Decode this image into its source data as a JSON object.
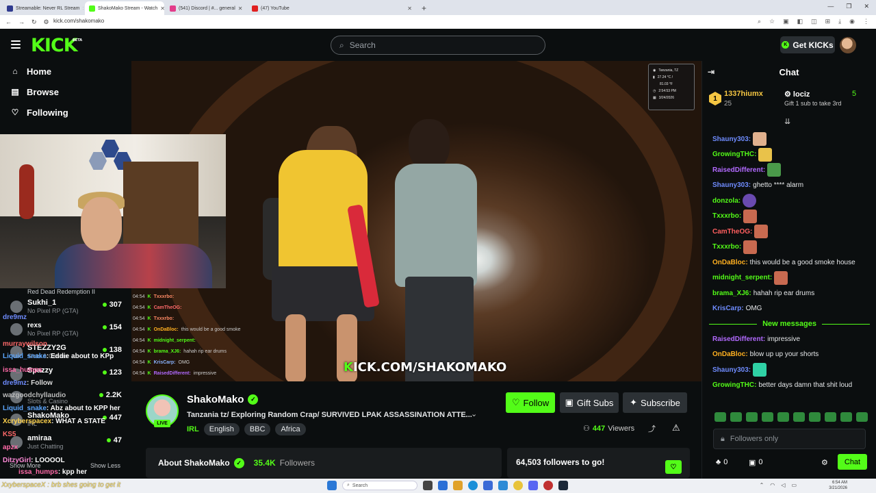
{
  "browser": {
    "tabs": [
      {
        "title": "Streamable: Never RL Stream",
        "active": false,
        "fav_color": "#2f3a8f"
      },
      {
        "title": "ShakoMako Stream - Watch",
        "active": true,
        "fav_color": "#53fc18"
      },
      {
        "title": "(541) Discord | #... general",
        "active": false,
        "fav_color": "#e23c8a"
      },
      {
        "title": "(47) YouTube",
        "active": false,
        "fav_color": "#e02020"
      }
    ],
    "new_tab": "+",
    "url": "kick.com/shakomako"
  },
  "header": {
    "logo": "KICK",
    "logo_badge": "BETA",
    "search_placeholder": "Search",
    "get_kicks": "Get KICKs"
  },
  "nav": [
    {
      "label": "Home",
      "icon": "home-icon"
    },
    {
      "label": "Browse",
      "icon": "browse-icon"
    },
    {
      "label": "Following",
      "icon": "heart-icon"
    }
  ],
  "webcam": {
    "caption": "Red Dead Redemption II"
  },
  "channels": [
    {
      "name": "Sukhi_1",
      "category": "No Pixel RP (GTA)",
      "viewers": "307"
    },
    {
      "name": "",
      "category": "No Pixel RP (GTA)",
      "viewers": "154"
    },
    {
      "name": "STEZZY2G",
      "category": "Slots & Casino",
      "viewers": "138"
    },
    {
      "name": "Spazzy",
      "category": "",
      "viewers": "123"
    },
    {
      "name": "",
      "category": "Slots & Casino",
      "viewers": "2.2K"
    },
    {
      "name": "ShakoMako",
      "category": "IRL",
      "viewers": "447"
    },
    {
      "name": "amiraa",
      "category": "Just Chatting",
      "viewers": "47"
    }
  ],
  "ghost_chat": [
    {
      "user": "dre9mz",
      "text": "",
      "color": "#6f8cff"
    },
    {
      "user": "rexs",
      "text": "",
      "color": "#ffffff"
    },
    {
      "user": "murraywilson",
      "text": ": Eddie about to KPp",
      "color": "#ff6a6a"
    },
    {
      "user": "Liquid_snake",
      "text": "",
      "color": "#5da7ff"
    },
    {
      "user": "issa_humps",
      "text": "",
      "color": "#ff6aa8"
    },
    {
      "user": "dre9mz",
      "text": ": Follow",
      "color": "#6f8cff"
    },
    {
      "user": "wazgoodchyllaudio",
      "text": "",
      "color": "#bbbbbb"
    },
    {
      "user": "Liquid_snake",
      "text": ": Abz about to KPP her",
      "color": "#5da7ff"
    },
    {
      "user": "Xcryberspacex",
      "text": ": WHAT A STATE",
      "color": "#ffd34d"
    },
    {
      "user": "KS5",
      "text": "",
      "color": "#ff6a6a"
    },
    {
      "user": "apzx",
      "text": "",
      "color": "#ff6aa8"
    },
    {
      "user": "DitzyGirl",
      "text": ": LOOOOL",
      "color": "#ff8ad8"
    },
    {
      "user": "issa_humps",
      "text": ": kpp her",
      "color": "#ff6aa8"
    }
  ],
  "sidebar_footer": {
    "show_more": "Show More",
    "show_less": "Show Less"
  },
  "video": {
    "location": "Tanzania, TZ",
    "temp": "27.24 °C /",
    "temp2": "81.03 °F",
    "time": "2:54:53 PM",
    "date": "3/24/2026",
    "watermark_brand": "K",
    "watermark_text": "ICK.COM/SHAKOMAKO",
    "overlay_chat": [
      {
        "time": "04:54",
        "user": "Txxxrbo:",
        "text": ""
      },
      {
        "time": "04:54",
        "user": "CamTheOG:",
        "text": ""
      },
      {
        "time": "04:54",
        "user": "Txxxrbo:",
        "text": ""
      },
      {
        "time": "04:54",
        "user": "OnDaBloc:",
        "text": "this would be a good smoke"
      },
      {
        "time": "04:54",
        "user": "midnight_serpent:",
        "text": ""
      },
      {
        "time": "04:54",
        "user": "brama_XJ6:",
        "text": "hahah rip ear drums"
      },
      {
        "time": "04:54",
        "user": "KrisCarp:",
        "text": "OMG"
      },
      {
        "time": "04:54",
        "user": "RaisedDifferent:",
        "text": "impressive"
      }
    ]
  },
  "stream": {
    "name": "ShakoMako",
    "live": "LIVE",
    "title": "Tanzania tz/ Exploring Random Crap/ SURVIVED LPAK ASSASSINATION ATTE...",
    "category": "IRL",
    "tags": [
      "English",
      "BBC",
      "Africa"
    ],
    "follow": "Follow",
    "gift_subs": "Gift Subs",
    "subscribe": "Subscribe",
    "viewers_count": "447",
    "viewers_label": "Viewers",
    "about": "About ShakoMako",
    "followers_count": "35.4K",
    "followers_label": "Followers",
    "goal": "64,503 followers to go!"
  },
  "chat": {
    "title": "Chat",
    "leader1": {
      "rank": "1",
      "name": "1337hiumx",
      "count": "25"
    },
    "leader2": {
      "name": "lociz",
      "count": "5",
      "sub": "Gift 1 sub to take 3rd"
    },
    "messages": [
      {
        "user": "Shauny303:",
        "text": "",
        "color": "#6f8cff",
        "emote": "#e0b08d"
      },
      {
        "user": "GrowingTHC:",
        "text": "",
        "color": "#53fc18",
        "emote": "#e9c24a"
      },
      {
        "user": "RaisedDifferent:",
        "text": "",
        "color": "#b26aff",
        "emote": "#4a9a4a"
      },
      {
        "user": "Shauny303:",
        "text": "ghetto **** alarm",
        "color": "#6f8cff",
        "emote": ""
      },
      {
        "user": "donzola:",
        "text": "",
        "color": "#53fc18",
        "emote": "#6a4ab0"
      },
      {
        "user": "Txxxrbo:",
        "text": "",
        "color": "#53fc18",
        "emote": "#c86a50"
      },
      {
        "user": "CamTheOG:",
        "text": "",
        "color": "#ff5f5f",
        "emote": "#c86a50"
      },
      {
        "user": "Txxxrbo:",
        "text": "",
        "color": "#53fc18",
        "emote": "#c86a50"
      },
      {
        "user": "OnDaBloc:",
        "text": "this would be a good smoke house",
        "color": "#ffb020",
        "emote": ""
      },
      {
        "user": "midnight_serpent:",
        "text": "",
        "color": "#53fc18",
        "emote": "#c86a50"
      },
      {
        "user": "brama_XJ6:",
        "text": "hahah rip ear drums",
        "color": "#53fc18",
        "emote": ""
      },
      {
        "user": "KrisCarp:",
        "text": "OMG",
        "color": "#6f8cff",
        "emote": ""
      }
    ],
    "new_messages": "New messages",
    "messages_after": [
      {
        "user": "RaisedDifferent:",
        "text": "impressive",
        "color": "#b26aff"
      },
      {
        "user": "OnDaBloc:",
        "text": "blow up up your shorts",
        "color": "#ffb020"
      },
      {
        "user": "Shauny303:",
        "text": "",
        "color": "#6f8cff"
      },
      {
        "user": "GrowingTHC:",
        "text": "better days damn that shit loud",
        "color": "#53fc18"
      }
    ],
    "input_placeholder": "Followers only",
    "kicks_count": "0",
    "subs_count": "0",
    "send": "Chat"
  },
  "taskbar": {
    "ticker": "XxyberspaceX : brb shes going to get it",
    "search": "Search",
    "time": "6:54 AM",
    "date": "3/21/2026"
  }
}
